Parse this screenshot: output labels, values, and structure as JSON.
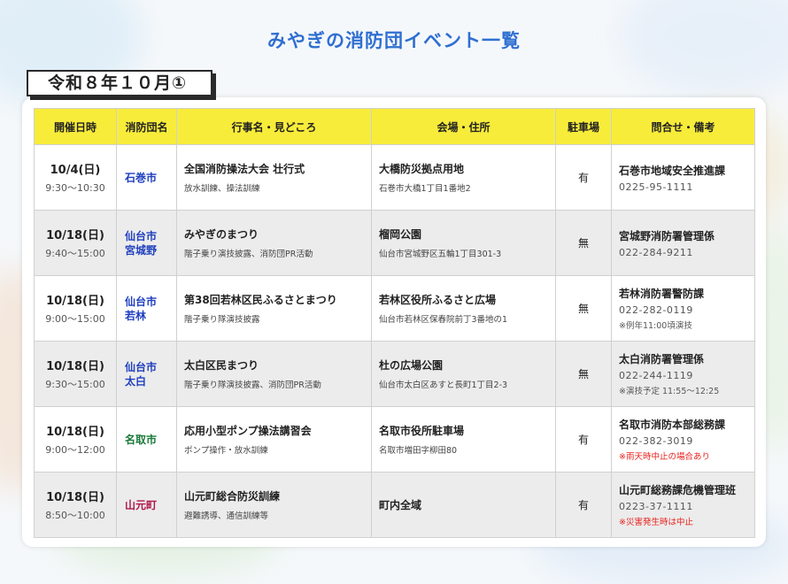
{
  "page": {
    "title": "みやぎの消防団イベント一覧",
    "month_label": "令和８年１０月①"
  },
  "table": {
    "headers": [
      "開催日時",
      "消防団名",
      "行事名・見どころ",
      "会場・住所",
      "駐車場",
      "問合せ・備考"
    ],
    "rows": [
      {
        "date": "10/4(日)",
        "time": "9:30～10:30",
        "org_line1": "石巻市",
        "org_line2": "",
        "org_color": "#1f3fbf",
        "event": "全国消防操法大会 壮行式",
        "event_detail": "放水訓練、操法訓練",
        "venue": "大橋防災拠点用地",
        "venue_addr": "石巻市大橋1丁目1番地2",
        "parking": "有",
        "contact": "石巻市地域安全推進課",
        "tel": "0225-95-1111",
        "note": "",
        "note_color": "#555555"
      },
      {
        "date": "10/18(日)",
        "time": "9:40～15:00",
        "org_line1": "仙台市",
        "org_line2": "宮城野",
        "org_color": "#1f3fbf",
        "event": "みやぎのまつり",
        "event_detail": "階子乗り演技披露、消防団PR活動",
        "venue": "榴岡公園",
        "venue_addr": "仙台市宮城野区五輪1丁目301-3",
        "parking": "無",
        "contact": "宮城野消防署管理係",
        "tel": "022-284-9211",
        "note": "",
        "note_color": "#555555"
      },
      {
        "date": "10/18(日)",
        "time": "9:00～15:00",
        "org_line1": "仙台市",
        "org_line2": "若林",
        "org_color": "#1f3fbf",
        "event": "第38回若林区民ふるさとまつり",
        "event_detail": "階子乗り隊演技披露",
        "venue": "若林区役所ふるさと広場",
        "venue_addr": "仙台市若林区保春院前丁3番地の1",
        "parking": "無",
        "contact": "若林消防署警防課",
        "tel": "022-282-0119",
        "note": "※例年11:00頃演技",
        "note_color": "#555555"
      },
      {
        "date": "10/18(日)",
        "time": "9:30～15:00",
        "org_line1": "仙台市",
        "org_line2": "太白",
        "org_color": "#1f3fbf",
        "event": "太白区民まつり",
        "event_detail": "階子乗り隊演技披露、消防団PR活動",
        "venue": "杜の広場公園",
        "venue_addr": "仙台市太白区あすと長町1丁目2-3",
        "parking": "無",
        "contact": "太白消防署管理係",
        "tel": "022-244-1119",
        "note": "※演技予定 11:55～12:25",
        "note_color": "#555555"
      },
      {
        "date": "10/18(日)",
        "time": "9:00～12:00",
        "org_line1": "名取市",
        "org_line2": "",
        "org_color": "#1a7a3a",
        "event": "応用小型ポンプ操法講習会",
        "event_detail": "ポンプ操作・放水訓練",
        "venue": "名取市役所駐車場",
        "venue_addr": "名取市増田字柳田80",
        "parking": "有",
        "contact": "名取市消防本部総務課",
        "tel": "022-382-3019",
        "note": "※雨天時中止の場合あり",
        "note_color": "#e8211c"
      },
      {
        "date": "10/18(日)",
        "time": "8:50～10:00",
        "org_line1": "山元町",
        "org_line2": "",
        "org_color": "#b0174a",
        "event": "山元町総合防災訓練",
        "event_detail": "避難誘導、通信訓練等",
        "venue": "町内全域",
        "venue_addr": "",
        "parking": "有",
        "contact": "山元町総務課危機管理班",
        "tel": "0223-37-1111",
        "note": "※災害発生時は中止",
        "note_color": "#e8211c"
      }
    ]
  }
}
